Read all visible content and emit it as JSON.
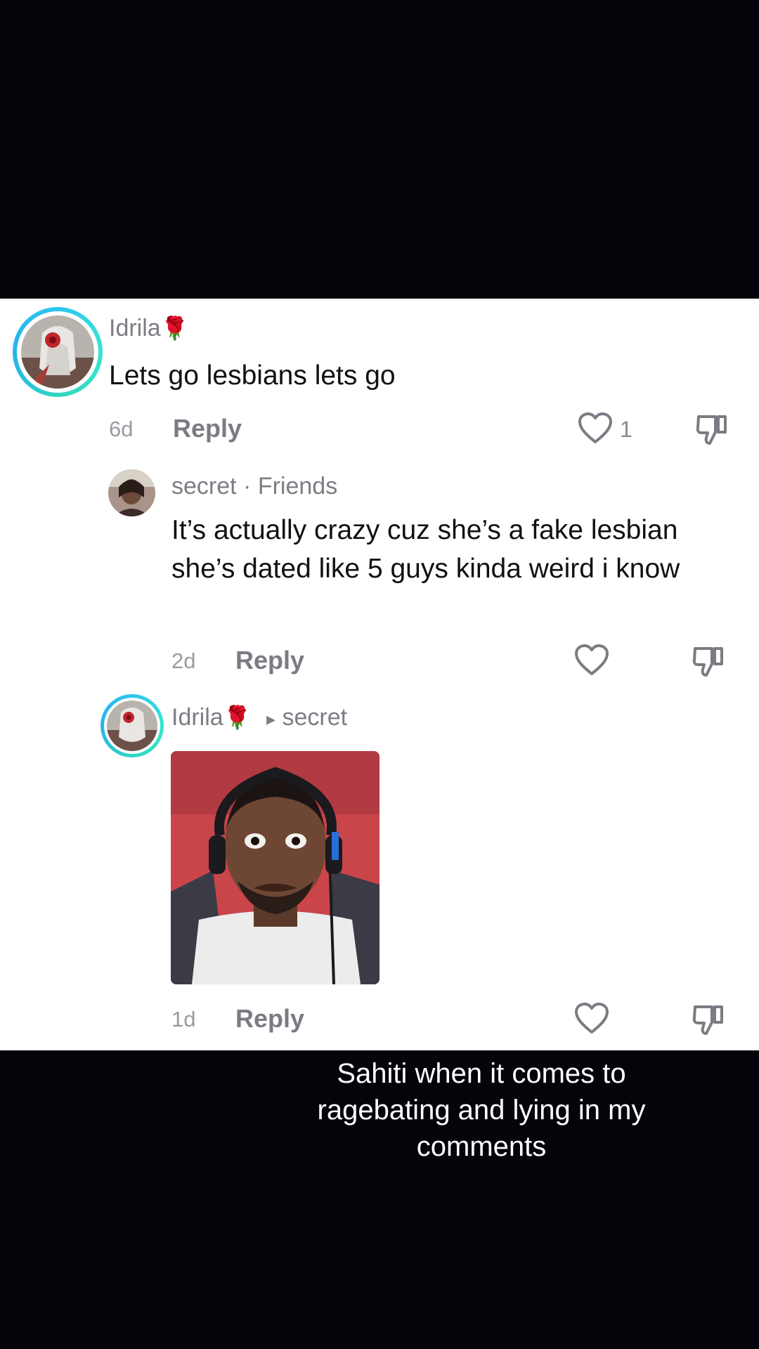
{
  "comments": [
    {
      "username": "Idrila",
      "username_emoji": "🌹",
      "text": "Lets go lesbians lets go",
      "time": "6d",
      "reply_label": "Reply",
      "like_count": "1"
    },
    {
      "username": "secret",
      "separator": "·",
      "tag": "Friends",
      "text": "It’s actually crazy cuz she’s a fake lesbian she’s dated like 5 guys kinda weird i know",
      "time": "2d",
      "reply_label": "Reply"
    },
    {
      "username": "Idrila",
      "username_emoji": "🌹",
      "reply_to_arrow": "▸",
      "reply_to": "secret",
      "attachment": "reaction-gif-image",
      "time": "1d",
      "reply_label": "Reply"
    }
  ],
  "caption": "Sahiti when it comes to ragebating and lying in my comments",
  "colors": {
    "avatar_ring": "#2ec5f0",
    "panel_bg": "#ffffff",
    "page_bg": "#05040b"
  }
}
